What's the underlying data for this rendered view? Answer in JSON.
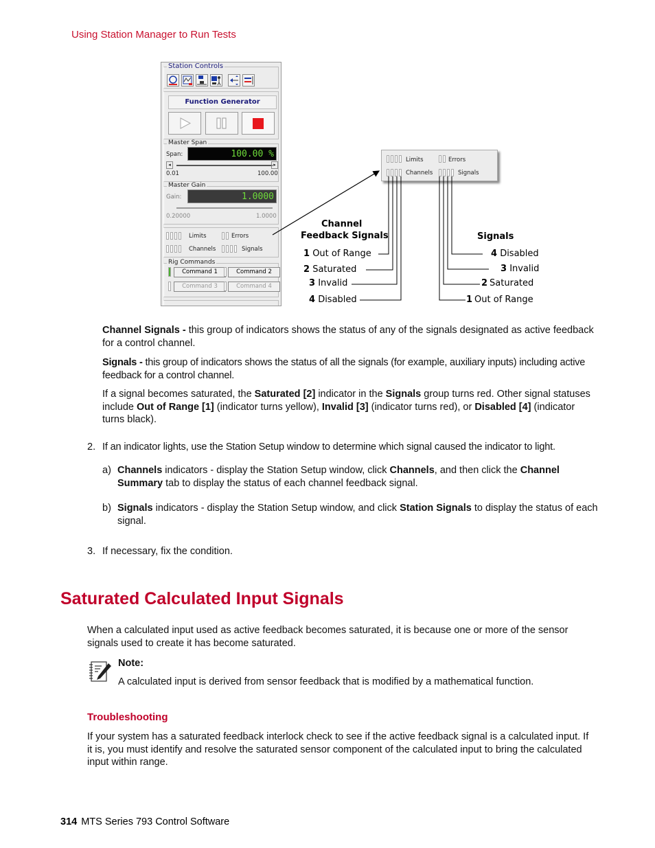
{
  "header": {
    "section_title": "Using Station Manager to Run Tests"
  },
  "figure": {
    "panel": {
      "title": "Station Controls",
      "toolbar_icons": [
        "station-icon",
        "scope-icon",
        "network-icon",
        "computer-user-icon",
        "exchange-icon",
        "panel-icon"
      ],
      "function_generator": {
        "title": "Function Generator",
        "buttons": [
          "play",
          "pause",
          "stop"
        ]
      },
      "master_span": {
        "group": "Master Span",
        "label": "Span:",
        "value": "100.00 %",
        "min": "0.01",
        "max": "100.00"
      },
      "master_gain": {
        "group": "Master Gain",
        "label": "Gain:",
        "value": "1.0000",
        "min": "0.20000",
        "max": "1.0000"
      },
      "indicators": {
        "limits": "Limits",
        "errors": "Errors",
        "channels": "Channels",
        "signals": "Signals"
      },
      "rig_commands": {
        "group": "Rig Commands",
        "commands": [
          "Command 1",
          "Command 2",
          "Command 3",
          "Command 4"
        ]
      }
    },
    "callout": {
      "limits": "Limits",
      "errors": "Errors",
      "channels": "Channels",
      "signals": "Signals"
    },
    "channel_feedback": {
      "title_line1": "Channel",
      "title_line2": "Feedback Signals",
      "items": [
        {
          "num": "1",
          "label": "Out of Range"
        },
        {
          "num": "2",
          "label": "Saturated"
        },
        {
          "num": "3",
          "label": "Invalid"
        },
        {
          "num": "4",
          "label": "Disabled"
        }
      ]
    },
    "signals": {
      "title": "Signals",
      "items": [
        {
          "num": "4",
          "label": "Disabled"
        },
        {
          "num": "3",
          "label": "Invalid"
        },
        {
          "num": "2",
          "label": "Saturated"
        },
        {
          "num": "1",
          "label": "Out of Range"
        }
      ]
    }
  },
  "body": {
    "channel_signals": {
      "term": "Channel Signals -",
      "text": " this group of indicators shows the status of any of the signals designated as active feedback for a control channel."
    },
    "signals_def": {
      "term": "Signals -",
      "text": " this group of indicators shows the status of all the signals (for example, auxiliary inputs) including active feedback for a control channel."
    },
    "saturated_para": {
      "t1": "If a signal becomes saturated, the ",
      "b1": "Saturated [2]",
      "t2": " indicator in the ",
      "b2": "Signals",
      "t3": " group turns red. Other signal statuses include ",
      "b3": "Out of Range [1]",
      "t4": " (indicator turns yellow), ",
      "b4": "Invalid [3]",
      "t5": " (indicator turns red), or ",
      "b5": "Disabled [4]",
      "t6": " (indicator turns black)."
    },
    "step2": {
      "num": "2.",
      "text": "If an indicator lights, use the Station Setup window to determine which signal caused the indicator to light."
    },
    "step2a": {
      "marker": "a)",
      "b1": "Channels",
      "t1": " indicators - display the Station Setup window, click ",
      "b2": "Channels",
      "t2": ", and then click the ",
      "b3": "Channel Summary",
      "t3": " tab to display the status of each channel feedback signal."
    },
    "step2b": {
      "marker": "b)",
      "b1": "Signals",
      "t1": " indicators - display the Station Setup window, and click ",
      "b2": "Station Signals",
      "t2": " to display the status of each signal."
    },
    "step3": {
      "num": "3.",
      "text": "If necessary, fix the condition."
    }
  },
  "section": {
    "title": "Saturated Calculated Input Signals",
    "intro": "When a calculated input used as active feedback becomes saturated, it is because one or more of the sensor signals used to create it has become saturated.",
    "note": {
      "label": "Note:",
      "text": "A calculated input is derived from sensor feedback that is modified by a mathematical function."
    },
    "troubleshooting": {
      "title": "Troubleshooting",
      "text": "If your system has a saturated feedback interlock check to see if the active feedback signal is a calculated input. If it is, you must identify and resolve the saturated sensor component of the calculated input to bring the calculated input within range."
    }
  },
  "footer": {
    "page_number": "314",
    "doc_title": "MTS Series 793 Control Software"
  },
  "colors": {
    "accent": "#c8102e",
    "lcd_text": "#6edb3a",
    "stop_red": "#e8171d",
    "cmd_green": "#4caf32"
  }
}
